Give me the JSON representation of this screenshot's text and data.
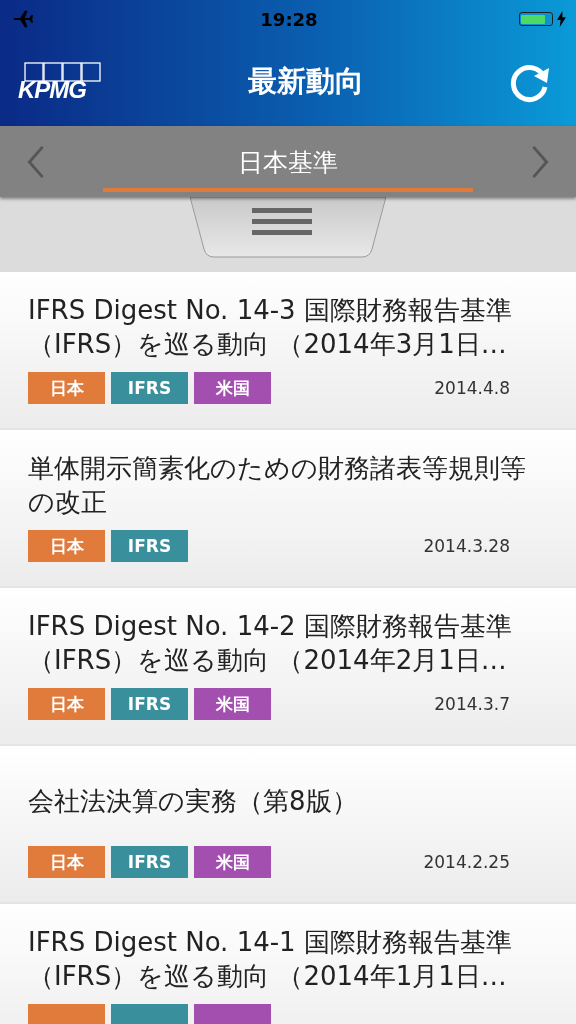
{
  "status_bar": {
    "time": "19:28"
  },
  "nav_bar": {
    "logo": "KPMG",
    "title": "最新動向"
  },
  "category_bar": {
    "label": "日本基準"
  },
  "articles": [
    {
      "title": "IFRS Digest No. 14-3 国際財務報告基準（IFRS）を巡る動向 （2014年3月1日…",
      "date": "2014.4.8",
      "tags": [
        {
          "kind": "japan",
          "label": "日本"
        },
        {
          "kind": "ifrs",
          "label": "IFRS"
        },
        {
          "kind": "us",
          "label": "米国"
        }
      ]
    },
    {
      "title": "単体開示簡素化のための財務諸表等規則等の改正",
      "date": "2014.3.28",
      "tags": [
        {
          "kind": "japan",
          "label": "日本"
        },
        {
          "kind": "ifrs",
          "label": "IFRS"
        }
      ]
    },
    {
      "title": "IFRS Digest No. 14-2 国際財務報告基準（IFRS）を巡る動向 （2014年2月1日…",
      "date": "2014.3.7",
      "tags": [
        {
          "kind": "japan",
          "label": "日本"
        },
        {
          "kind": "ifrs",
          "label": "IFRS"
        },
        {
          "kind": "us",
          "label": "米国"
        }
      ]
    },
    {
      "title": "会社法決算の実務（第8版）",
      "date": "2014.2.25",
      "tags": [
        {
          "kind": "japan",
          "label": "日本"
        },
        {
          "kind": "ifrs",
          "label": "IFRS"
        },
        {
          "kind": "us",
          "label": "米国"
        }
      ]
    },
    {
      "title": "IFRS Digest No. 14-1 国際財務報告基準（IFRS）を巡る動向 （2014年1月1日…",
      "tags": [
        {
          "kind": "japan"
        },
        {
          "kind": "ifrs"
        },
        {
          "kind": "us"
        }
      ]
    }
  ]
}
